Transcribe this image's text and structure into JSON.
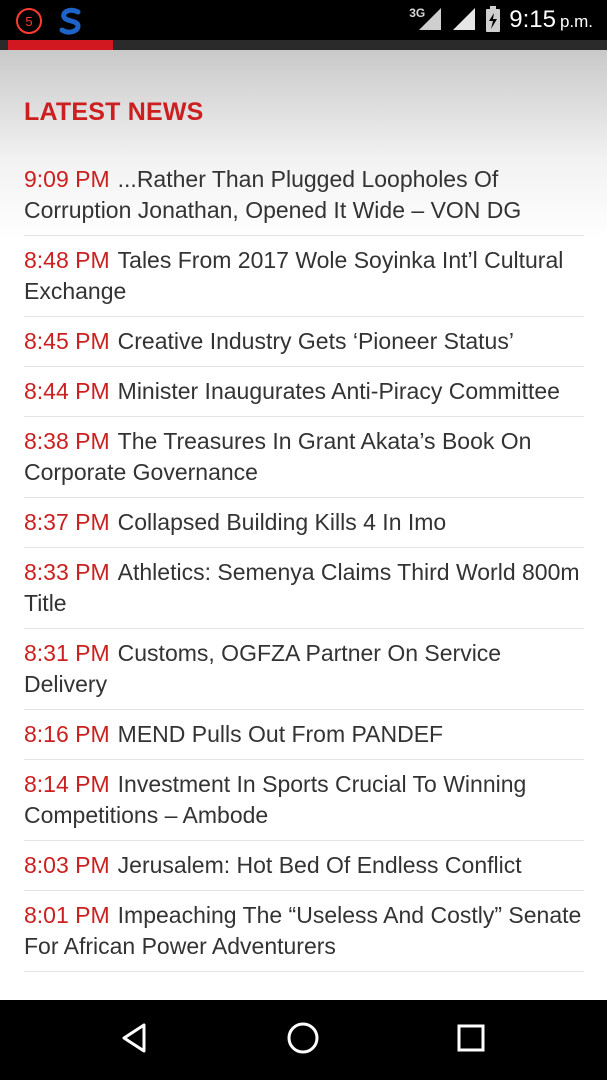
{
  "status_bar": {
    "time": "9:15",
    "time_suffix": "p.m.",
    "network": "3G",
    "app_badge": "5",
    "icons": [
      "notification-badge-icon",
      "s-logo-icon",
      "signal-icon",
      "signal-icon",
      "battery-charging-icon"
    ]
  },
  "colors": {
    "accent": "#cc1f1f",
    "tab_indicator": "#d1171f",
    "text": "#333333"
  },
  "section": {
    "title": "LATEST NEWS"
  },
  "news": [
    {
      "time": "9:09 PM",
      "headline": "...Rather Than Plugged Loopholes Of Corruption Jonathan, Opened It Wide – VON DG"
    },
    {
      "time": "8:48 PM",
      "headline": "Tales From 2017 Wole Soyinka Int’l Cultural Exchange"
    },
    {
      "time": "8:45 PM",
      "headline": "Creative Industry Gets ‘Pioneer Status’"
    },
    {
      "time": "8:44 PM",
      "headline": "Minister Inaugurates Anti-Piracy Committee"
    },
    {
      "time": "8:38 PM",
      "headline": "The Treasures In Grant Akata’s Book On Corporate Governance"
    },
    {
      "time": "8:37 PM",
      "headline": "Collapsed Building Kills 4 In Imo"
    },
    {
      "time": "8:33 PM",
      "headline": "Athletics: Semenya Claims Third World 800m Title"
    },
    {
      "time": "8:31 PM",
      "headline": "Customs, OGFZA Partner On Service Delivery"
    },
    {
      "time": "8:16 PM",
      "headline": "MEND Pulls Out From PANDEF"
    },
    {
      "time": "8:14 PM",
      "headline": "Investment In Sports Crucial To Winning Competitions – Ambode"
    },
    {
      "time": "8:03 PM",
      "headline": "Jerusalem: Hot Bed Of Endless Conflict"
    },
    {
      "time": "8:01 PM",
      "headline": "Impeaching The “Useless And Costly” Senate For African Power Adventurers"
    }
  ],
  "nav_bar": {
    "icons": [
      "back-icon",
      "home-icon",
      "recents-icon"
    ]
  }
}
